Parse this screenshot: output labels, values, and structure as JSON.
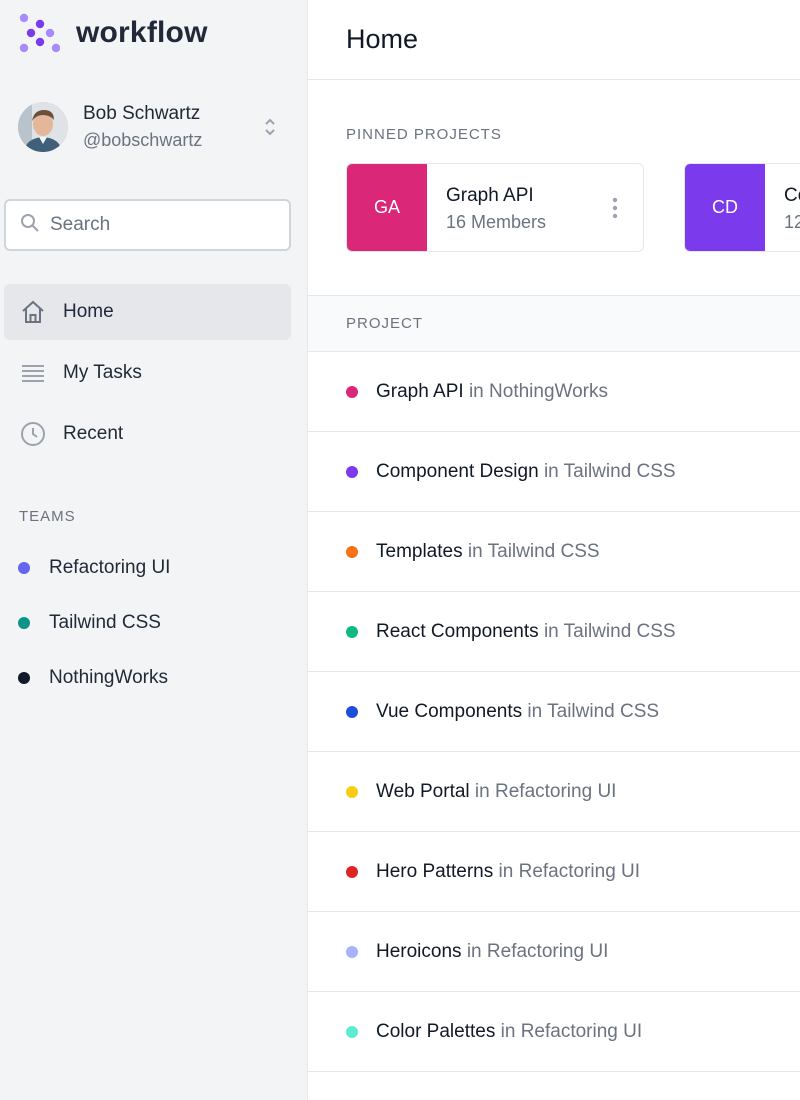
{
  "app": {
    "name": "workflow",
    "accent": "#7c3aed"
  },
  "user": {
    "name": "Bob Schwartz",
    "handle": "@bobschwartz"
  },
  "search": {
    "placeholder": "Search"
  },
  "nav": {
    "items": [
      {
        "label": "Home",
        "icon": "home-icon",
        "active": true
      },
      {
        "label": "My Tasks",
        "icon": "list-icon",
        "active": false
      },
      {
        "label": "Recent",
        "icon": "clock-icon",
        "active": false
      }
    ]
  },
  "teams": {
    "heading": "TEAMS",
    "items": [
      {
        "label": "Refactoring UI",
        "color": "#6366f1"
      },
      {
        "label": "Tailwind CSS",
        "color": "#0d9488"
      },
      {
        "label": "NothingWorks",
        "color": "#111827"
      }
    ]
  },
  "main": {
    "title": "Home",
    "pinned_heading": "PINNED PROJECTS",
    "pinned": [
      {
        "initials": "GA",
        "title": "Graph API",
        "members": "16 Members",
        "color": "#db2777"
      },
      {
        "initials": "CD",
        "title": "Co",
        "members": "12",
        "color": "#7c3aed"
      }
    ],
    "table_heading": "PROJECT",
    "in_word": "in",
    "projects": [
      {
        "name": "Graph API",
        "team": "NothingWorks",
        "color": "#db2777"
      },
      {
        "name": "Component Design",
        "team": "Tailwind CSS",
        "color": "#7c3aed"
      },
      {
        "name": "Templates",
        "team": "Tailwind CSS",
        "color": "#f97316"
      },
      {
        "name": "React Components",
        "team": "Tailwind CSS",
        "color": "#10b981"
      },
      {
        "name": "Vue Components",
        "team": "Tailwind CSS",
        "color": "#1d4ed8"
      },
      {
        "name": "Web Portal",
        "team": "Refactoring UI",
        "color": "#facc15"
      },
      {
        "name": "Hero Patterns",
        "team": "Refactoring UI",
        "color": "#dc2626"
      },
      {
        "name": "Heroicons",
        "team": "Refactoring UI",
        "color": "#a5b4fc"
      },
      {
        "name": "Color Palettes",
        "team": "Refactoring UI",
        "color": "#5eead4"
      }
    ]
  }
}
